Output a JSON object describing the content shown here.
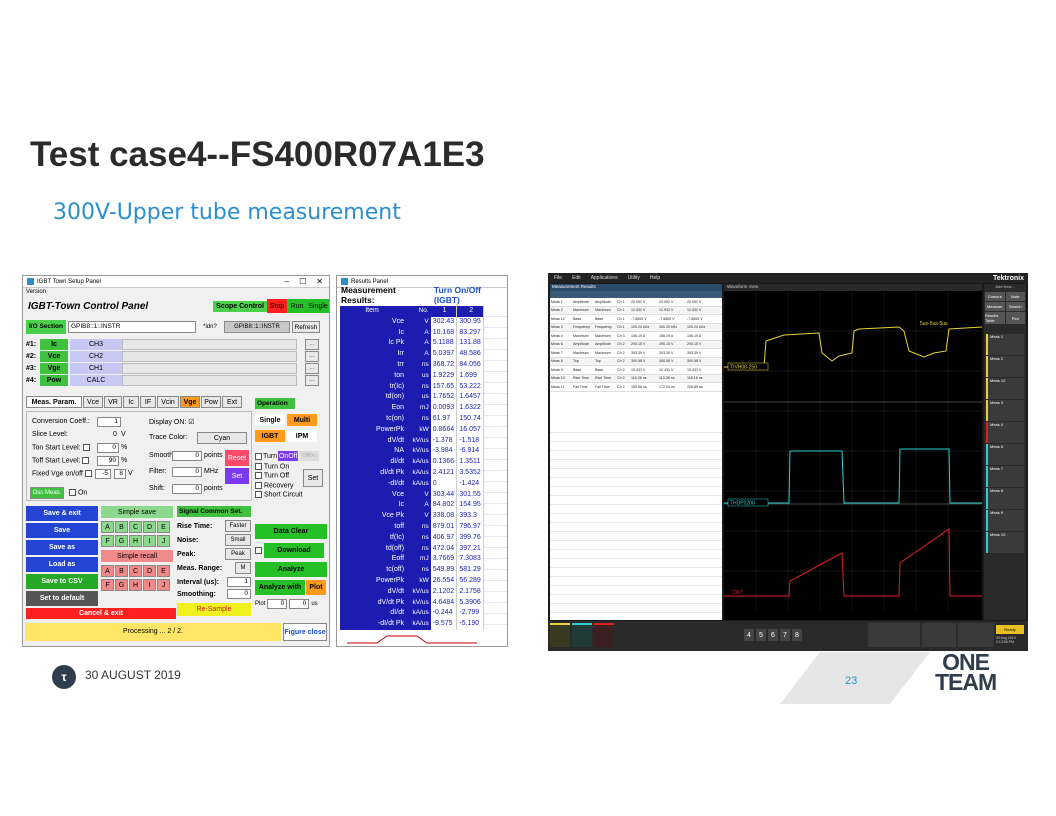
{
  "slide": {
    "title": "Test case4--FS400R07A1E3",
    "subtitle": "300V-Upper tube measurement",
    "date": "30 AUGUST 2019",
    "page": "23",
    "logo_line1": "ONE",
    "logo_line2": "TEAM"
  },
  "setup_panel": {
    "window_title": "IGBT Town Setup Panel",
    "version": "Version",
    "header": "IGBT-Town Control Panel",
    "scope_control": "Scope Control",
    "stop": "Stop",
    "run": "Run",
    "single": "Single",
    "io_section": "I/O Section",
    "io_value": "GPIB8::1::INSTR",
    "idn": "*idn?",
    "idn_value": "GPIB8::1::INSTR",
    "refresh": "Refresh",
    "channels": [
      {
        "num": "#1:",
        "name": "Ic",
        "ch": "CH3"
      },
      {
        "num": "#2:",
        "name": "Vce",
        "ch": "CH2"
      },
      {
        "num": "#3:",
        "name": "Vge",
        "ch": "CH1"
      },
      {
        "num": "#4:",
        "name": "Pow",
        "ch": "CALC"
      }
    ],
    "tabs": [
      "Meas. Param.",
      "Vce",
      "VR",
      "Ic",
      "IF",
      "Vcin",
      "Vge",
      "Pow",
      "Ext"
    ],
    "conversion_coeff": "Conversion Coeff.:",
    "conversion_val": "1",
    "slice_level": "Slice Level:",
    "slice_val": "0",
    "slice_unit": "V",
    "ton_start": "Ton Start Level:",
    "ton_val": "0",
    "toff_start": "Toff Start Level:",
    "toff_val": "90",
    "fixed_vge": "Fixed Vge on/off",
    "fixed_val1": "-5",
    "fixed_val2": "8",
    "pct": "%",
    "display_on": "Display ON:",
    "trace_color": "Trace Color:",
    "trace_color_val": "Cyan",
    "smooth": "Smooth:",
    "smooth_val": "0",
    "points": "points",
    "filter": "Filter:",
    "filter_val": "0",
    "mhz": "MHz",
    "shift": "Shift:",
    "shift_val": "0",
    "reset": "Reset",
    "set": "Set",
    "osc_meas": "Osc Meas.",
    "on": "On",
    "operation": "Operation",
    "single_op": "Single",
    "multi": "Multi",
    "igbt": "IGBT",
    "ipm": "IPM",
    "turn_onoff": "Turn",
    "onoff_btn": "OnOff",
    "off_btn": "OffOn",
    "turn_on": "Turn On",
    "turn_off": "Turn Off",
    "recovery": "Recovery",
    "short_circuit": "Short Circuit",
    "set2": "Set",
    "save_exit": "Save & exit",
    "save": "Save",
    "save_as": "Save as",
    "load_as": "Load as",
    "save_csv": "Save to CSV",
    "set_default": "Set to default",
    "cancel_exit": "Cancel & exit",
    "simple_save": "Simple save",
    "simple_recall": "Simple recall",
    "letters1": [
      "A",
      "B",
      "C",
      "D",
      "E"
    ],
    "letters2": [
      "F",
      "G",
      "H",
      "I",
      "J"
    ],
    "signal_common": "Signal Common Set.",
    "rise_time": "Rise Time:",
    "rise_val": "Faster",
    "noise": "Noise:",
    "noise_val": "Small",
    "peak": "Peak:",
    "peak_val": "Peak",
    "meas_range": "Meas. Range:",
    "meas_range_val": "M",
    "interval": "Interval (us):",
    "interval_val": "1",
    "smoothing": "Smoothing:",
    "smoothing_val": "0",
    "re_sample": "Re-Sample",
    "data_clear": "Data Clear",
    "download": "Download",
    "analyze": "Analyze",
    "analyze_with": "Analyze with",
    "plot": "Plot",
    "plot_label": "Plot",
    "plot_val1": "0",
    "plot_val2": "0",
    "plot_unit": "us",
    "processing": "Processing ... 2 / 2.",
    "figure_close": "Figure close"
  },
  "results_panel": {
    "window_title": "Results Panel",
    "title": "Measurement Results:",
    "mode": "Turn On/Off (IGBT)",
    "header": {
      "item": "Item",
      "no": "No.",
      "c1": "1",
      "c2": "2"
    },
    "rows": [
      {
        "n": "Vce",
        "u": "V",
        "a": "302.43",
        "b": "300.95"
      },
      {
        "n": "Ic",
        "u": "A",
        "a": "10.168",
        "b": "83.297"
      },
      {
        "n": "Ic Pk",
        "u": "A",
        "a": "5.1188",
        "b": "131.88"
      },
      {
        "n": "Irr",
        "u": "A",
        "a": "5.0397",
        "b": "48.586"
      },
      {
        "n": "trr",
        "u": "ns",
        "a": "368.72",
        "b": "84.056"
      },
      {
        "n": "ton",
        "u": "us",
        "a": "1.9229",
        "b": "1.699"
      },
      {
        "n": "tr(Ic)",
        "u": "ns",
        "a": "157.65",
        "b": "53.222"
      },
      {
        "n": "td(on)",
        "u": "us",
        "a": "1.7652",
        "b": "1.6457"
      },
      {
        "n": "Eon",
        "u": "mJ",
        "a": "0.0093",
        "b": "1.6322"
      },
      {
        "n": "tc(on)",
        "u": "ns",
        "a": "61.97",
        "b": "150.74"
      },
      {
        "n": "PowerPk",
        "u": "kW",
        "a": "0.8664",
        "b": "16.057"
      },
      {
        "n": "dV/dt",
        "u": "kV/us",
        "a": "-1.378",
        "b": "-1.518"
      },
      {
        "n": "NA",
        "u": "kV/us",
        "a": "-3.984",
        "b": "-6.914"
      },
      {
        "n": "dI/dt",
        "u": "kA/us",
        "a": "0.1366",
        "b": "1.3511"
      },
      {
        "n": "dI/dt Pk",
        "u": "kA/us",
        "a": "2.4121",
        "b": "3.5352"
      },
      {
        "n": "-dI/dt",
        "u": "kA/us",
        "a": "0",
        "b": "-1.424"
      },
      {
        "n": "Vce",
        "u": "V",
        "a": "303.44",
        "b": "301.55"
      },
      {
        "n": "Ic",
        "u": "A",
        "a": "84.802",
        "b": "154.95"
      },
      {
        "n": "Vce Pk",
        "u": "V",
        "a": "338.08",
        "b": "393.3"
      },
      {
        "n": "toff",
        "u": "ns",
        "a": "879.01",
        "b": "796.97"
      },
      {
        "n": "tf(Ic)",
        "u": "ns",
        "a": "406.97",
        "b": "399.76"
      },
      {
        "n": "td(off)",
        "u": "ns",
        "a": "472.04",
        "b": "397.21"
      },
      {
        "n": "Eoff",
        "u": "mJ",
        "a": "3.7669",
        "b": "7.3083"
      },
      {
        "n": "tc(off)",
        "u": "ns",
        "a": "549.89",
        "b": "581.29"
      },
      {
        "n": "PowerPk",
        "u": "kW",
        "a": "26.554",
        "b": "56.289"
      },
      {
        "n": "dV/dt",
        "u": "kV/us",
        "a": "2.1202",
        "b": "2.1758"
      },
      {
        "n": "dV/dt Pk",
        "u": "kV/us",
        "a": "4.6484",
        "b": "5.3906"
      },
      {
        "n": "dI/dt",
        "u": "kA/us",
        "a": "-0.244",
        "b": "-2.799"
      },
      {
        "n": "-dI/dt Pk",
        "u": "kA/us",
        "a": "-9.575",
        "b": "-5.190"
      }
    ]
  },
  "scope": {
    "menu": [
      "File",
      "Edit",
      "Applications",
      "Utility",
      "Help"
    ],
    "brand": "Tektronix",
    "add_new": "Add New...",
    "meas_results_title": "Measurement Results",
    "waveform_view": "Waveform View",
    "meas_rows": [
      [
        "Meas 1",
        "Amplitude",
        "Amplitude",
        "Ch 1",
        "20.092 V",
        "20.092 V",
        "20.092 V"
      ],
      [
        "Meas 2",
        "Maximum",
        "Maximum",
        "Ch 1",
        "12.932 V",
        "12.932 V",
        "12.932 V"
      ],
      [
        "Meas 12",
        "Base",
        "Base",
        "Ch 1",
        "-7.6600 V",
        "-7.6600 V",
        "-7.6600 V"
      ],
      [
        "Meas 3",
        "Frequency",
        "Frequency",
        "Ch 1",
        "100.20 kHz",
        "100.20 kHz",
        "100.20 kHz"
      ],
      [
        "Meas 4",
        "Maximum",
        "Maximum",
        "Ch 3",
        "156.19 A",
        "156.19 A",
        "156.19 A"
      ],
      [
        "Meas 6",
        "Amplitude",
        "Amplitude",
        "Ch 2",
        "290.15 V",
        "290.15 V",
        "290.15 V"
      ],
      [
        "Meas 7",
        "Maximum",
        "Maximum",
        "Ch 2",
        "393.30 V",
        "393.30 V",
        "393.30 V"
      ],
      [
        "Meas 8",
        "Top",
        "Top",
        "Ch 2",
        "300.58 V",
        "300.58 V",
        "300.58 V"
      ],
      [
        "Meas 9",
        "Base",
        "Base",
        "Ch 2",
        "10.431 V",
        "10.431 V",
        "10.431 V"
      ],
      [
        "Meas 10",
        "Rise Time",
        "Rise Time",
        "Ch 2",
        "116.28 ns",
        "113.28 ns",
        "116.18 ns"
      ],
      [
        "Meas 11",
        "Fall Time",
        "Fall Time",
        "Ch 2",
        "159.56 ns",
        "172.24 ns",
        "226.89 ns"
      ]
    ],
    "labels": {
      "ch1": "TIVH08-250",
      "ch2": "THDP0200",
      "ch3": "CWT",
      "sus": "5us-5us-5us"
    },
    "side": [
      "Cursors",
      "Note",
      "Measure",
      "Search",
      "Results Table",
      "Plot"
    ],
    "side_meas": [
      "Meas 1",
      "Meas 2",
      "Meas 12",
      "Meas 3",
      "Meas 4",
      "Meas 6",
      "Meas 7",
      "Meas 8",
      "Meas 9",
      "Meas 10"
    ],
    "ready": "Ready",
    "datetime": "30 Aug 2019 2:13:56 PM",
    "bottom_nums": [
      "4",
      "5",
      "6",
      "7",
      "8"
    ]
  }
}
